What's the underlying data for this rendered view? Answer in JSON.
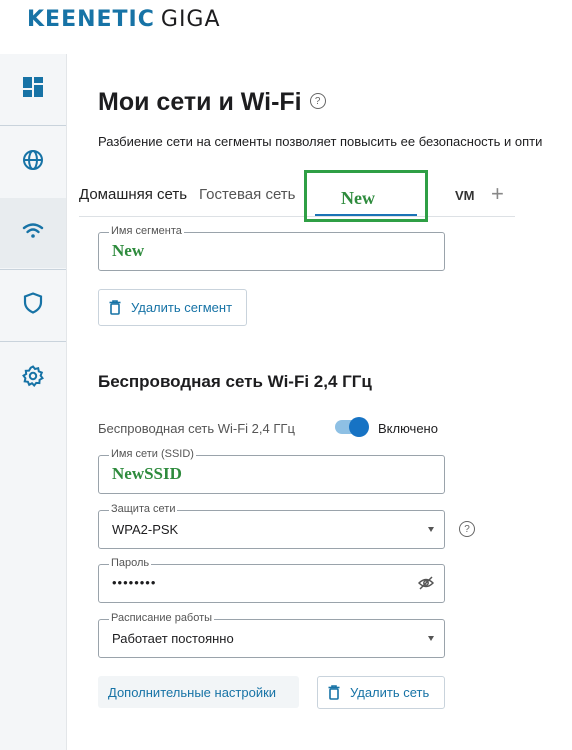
{
  "brand": {
    "name": "KEENETIC",
    "model": "GIGA"
  },
  "sidebar": {
    "items": [
      {
        "name": "dashboard",
        "icon": "dashboard-icon"
      },
      {
        "name": "internet",
        "icon": "globe-icon"
      },
      {
        "name": "wifi",
        "icon": "wifi-icon",
        "active": true
      },
      {
        "name": "security",
        "icon": "shield-icon"
      },
      {
        "name": "settings",
        "icon": "gear-icon"
      }
    ]
  },
  "page": {
    "title": "Мои сети и Wi-Fi",
    "help_icon": "?",
    "description": "Разбиение сети на сегменты позволяет повысить ее безопасность и опти"
  },
  "tabs": [
    {
      "label": "Домашняя сеть"
    },
    {
      "label": "Гостевая сеть"
    },
    {
      "label": "New",
      "active": true
    },
    {
      "label": "VM"
    }
  ],
  "tab_add": "+",
  "segment": {
    "name_legend": "Имя сегмента",
    "name_value": "New",
    "delete_label": "Удалить сегмент"
  },
  "wifi": {
    "section_title": "Беспроводная сеть Wi-Fi 2,4 ГГц",
    "toggle_label": "Беспроводная сеть Wi-Fi 2,4 ГГц",
    "toggle_state": "Включено",
    "toggle_on": true,
    "ssid_legend": "Имя сети (SSID)",
    "ssid_value": "NewSSID",
    "security_legend": "Защита сети",
    "security_value": "WPA2-PSK",
    "password_legend": "Пароль",
    "password_value": "••••••••",
    "schedule_legend": "Расписание работы",
    "schedule_value": "Работает постоянно",
    "advanced_label": "Дополнительные настройки",
    "delete_network_label": "Удалить сеть"
  },
  "colors": {
    "accent": "#1773a6",
    "highlight": "#2f9f45",
    "green_text": "#2e8b3d"
  }
}
